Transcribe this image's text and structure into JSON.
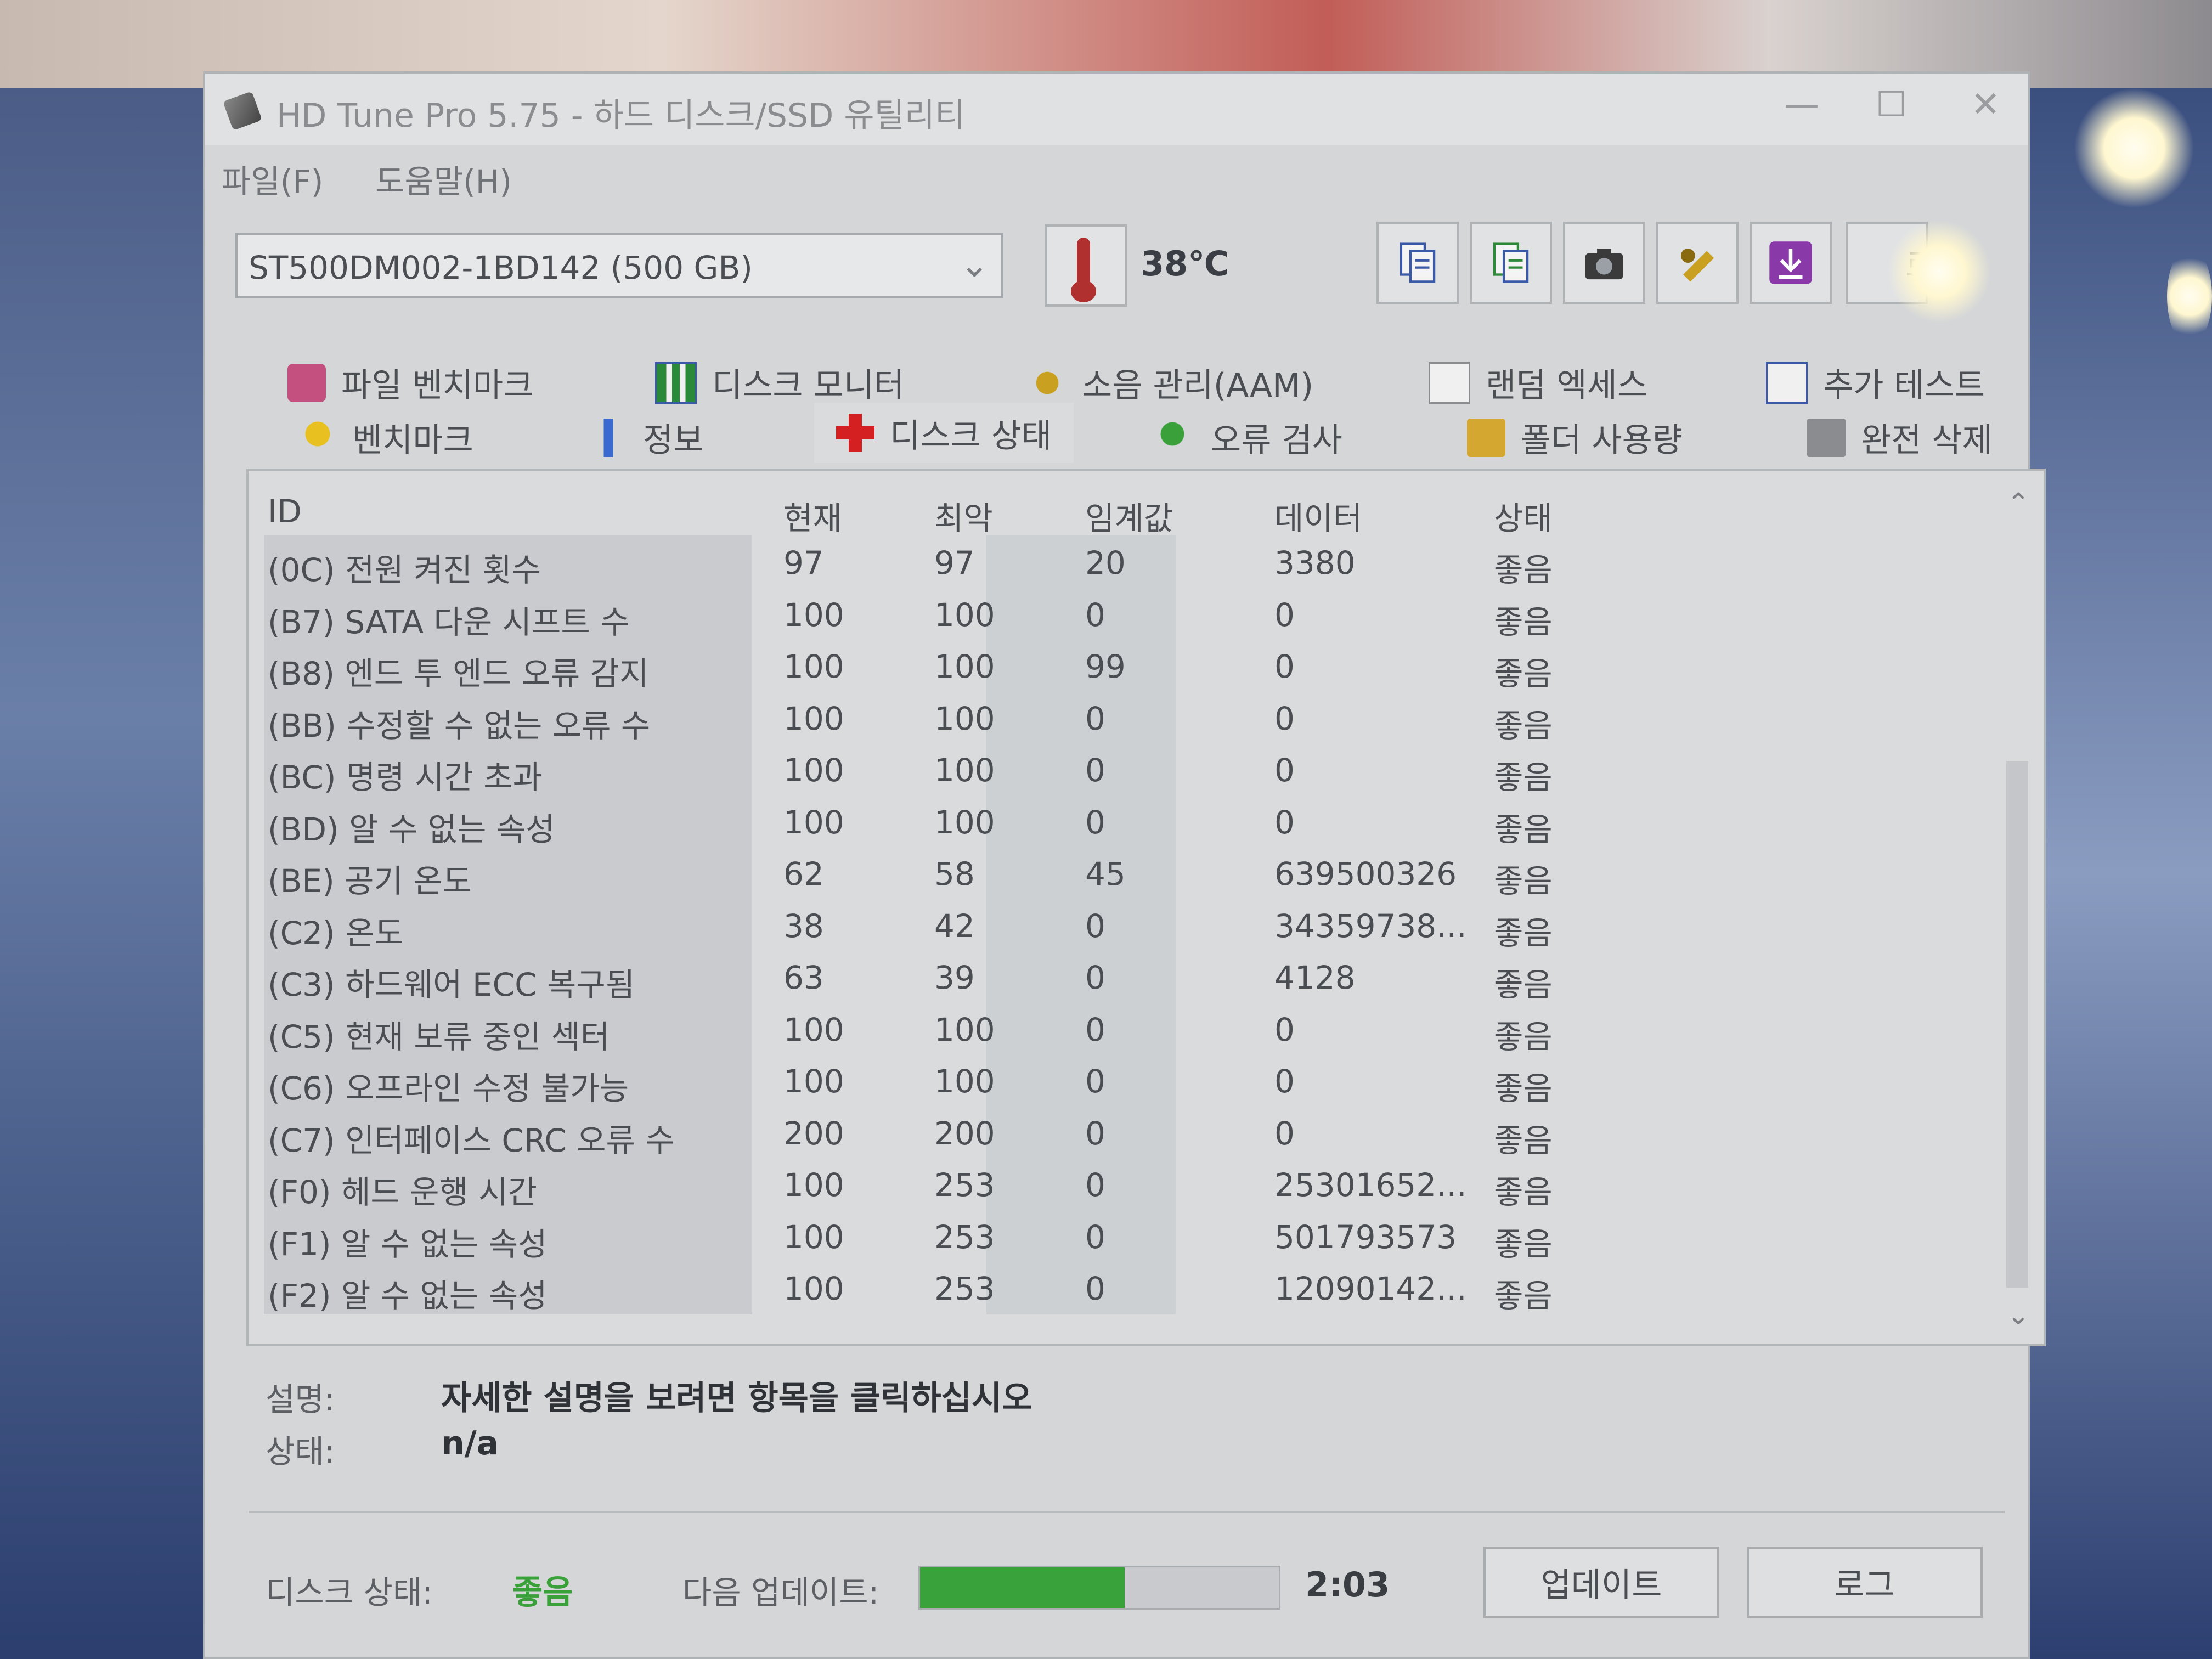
{
  "app": {
    "title": "HD Tune Pro 5.75 - 하드 디스크/SSD 유틸리티",
    "menu": [
      "파일(F)",
      "도움말(H)"
    ]
  },
  "toolbar": {
    "drive": "ST500DM002-1BD142 (500 GB)",
    "temperature": "38℃",
    "exit_label": "료",
    "icons": [
      "copy-info-icon",
      "copy-all-icon",
      "screenshot-icon",
      "options-icon",
      "save-download-icon"
    ]
  },
  "tabs": {
    "row1": [
      {
        "label": "파일 벤치마크",
        "icon": "file-benchmark-icon"
      },
      {
        "label": "디스크 모니터",
        "icon": "disk-monitor-icon"
      },
      {
        "label": "소음 관리(AAM)",
        "icon": "speaker-icon"
      },
      {
        "label": "랜덤 엑세스",
        "icon": "random-access-icon"
      },
      {
        "label": "추가 테스트",
        "icon": "extra-tests-icon"
      }
    ],
    "row2": [
      {
        "label": "벤치마크",
        "icon": "benchmark-icon"
      },
      {
        "label": "정보",
        "icon": "info-icon"
      },
      {
        "label": "디스크 상태",
        "icon": "health-cross-icon",
        "active": true
      },
      {
        "label": "오류 검사",
        "icon": "magnifier-icon"
      },
      {
        "label": "폴더 사용량",
        "icon": "folder-icon"
      },
      {
        "label": "완전 삭제",
        "icon": "trash-icon"
      }
    ]
  },
  "smart": {
    "headers": [
      "ID",
      "현재",
      "최악",
      "임계값",
      "데이터",
      "상태"
    ],
    "rows": [
      [
        "(0C) 전원 켜진 횟수",
        "97",
        "97",
        "20",
        "3380",
        "좋음"
      ],
      [
        "(B7) SATA 다운 시프트 수",
        "100",
        "100",
        "0",
        "0",
        "좋음"
      ],
      [
        "(B8) 엔드 투 엔드 오류 감지",
        "100",
        "100",
        "99",
        "0",
        "좋음"
      ],
      [
        "(BB) 수정할 수 없는 오류 수",
        "100",
        "100",
        "0",
        "0",
        "좋음"
      ],
      [
        "(BC) 명령 시간 초과",
        "100",
        "100",
        "0",
        "0",
        "좋음"
      ],
      [
        "(BD) 알 수 없는 속성",
        "100",
        "100",
        "0",
        "0",
        "좋음"
      ],
      [
        "(BE) 공기 온도",
        "62",
        "58",
        "45",
        "639500326",
        "좋음"
      ],
      [
        "(C2) 온도",
        "38",
        "42",
        "0",
        "34359738...",
        "좋음"
      ],
      [
        "(C3) 하드웨어 ECC 복구됨",
        "63",
        "39",
        "0",
        "4128",
        "좋음"
      ],
      [
        "(C5) 현재 보류 중인 섹터",
        "100",
        "100",
        "0",
        "0",
        "좋음"
      ],
      [
        "(C6) 오프라인 수정 불가능",
        "100",
        "100",
        "0",
        "0",
        "좋음"
      ],
      [
        "(C7) 인터페이스 CRC 오류 수",
        "200",
        "200",
        "0",
        "0",
        "좋음"
      ],
      [
        "(F0) 헤드 운행 시간",
        "100",
        "253",
        "0",
        "25301652...",
        "좋음"
      ],
      [
        "(F1) 알 수 없는 속성",
        "100",
        "253",
        "0",
        "501793573",
        "좋음"
      ],
      [
        "(F2) 알 수 없는 속성",
        "100",
        "253",
        "0",
        "12090142...",
        "좋음"
      ]
    ]
  },
  "description": {
    "desc_label": "설명:",
    "desc_value": "자세한 설명을 보려면 항목을 클릭하십시오",
    "status_label": "상태:",
    "status_value": "n/a"
  },
  "status": {
    "disk_status_label": "디스크 상태:",
    "disk_status_value": "좋음",
    "next_update_label": "다음 업데이트:",
    "progress": 0.57,
    "countdown": "2:03",
    "update_button": "업데이트",
    "log_button": "로그"
  },
  "colors": {
    "good": "#3aa03a",
    "progress": "#3aa23a"
  }
}
